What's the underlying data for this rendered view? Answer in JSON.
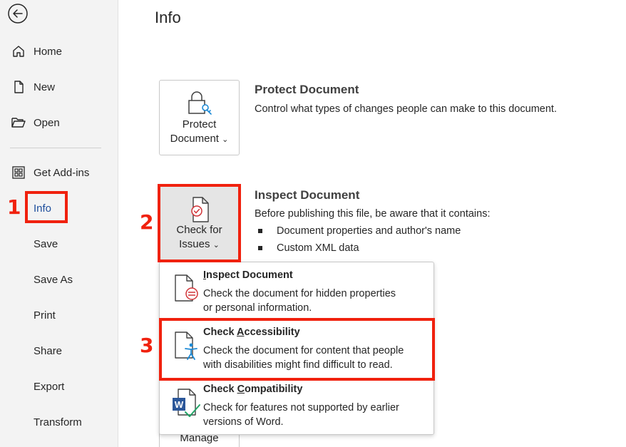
{
  "sidebar": {
    "items": [
      {
        "label": "Home"
      },
      {
        "label": "New"
      },
      {
        "label": "Open"
      },
      {
        "label": "Get Add-ins"
      },
      {
        "label": "Info"
      },
      {
        "label": "Save"
      },
      {
        "label": "Save As"
      },
      {
        "label": "Print"
      },
      {
        "label": "Share"
      },
      {
        "label": "Export"
      },
      {
        "label": "Transform"
      }
    ]
  },
  "callouts": [
    "1",
    "2",
    "3"
  ],
  "main": {
    "title": "Info",
    "protect": {
      "button_line1": "Protect",
      "button_line2": "Document",
      "chevron": "⌄",
      "title": "Protect Document",
      "desc": "Control what types of changes people can make to this document."
    },
    "inspect": {
      "button_line1": "Check for",
      "button_line2": "Issues",
      "chevron": "⌄",
      "title": "Inspect Document",
      "desc": "Before publishing this file, be aware that it contains:",
      "bullets": [
        "Document properties and author's name",
        "Custom XML data"
      ]
    },
    "manage_label": "Manage"
  },
  "dropdown": {
    "items": [
      {
        "title_prefix": "",
        "title_accel": "I",
        "title_rest": "nspect Document",
        "line1": "Check the document for hidden properties",
        "line2": "or personal information."
      },
      {
        "title_prefix": "Check ",
        "title_accel": "A",
        "title_rest": "ccessibility",
        "line1": "Check the document for content that people",
        "line2": "with disabilities might find difficult to read."
      },
      {
        "title_prefix": "Check ",
        "title_accel": "C",
        "title_rest": "ompatibility",
        "line1": "Check for features not supported by earlier",
        "line2": "versions of Word."
      }
    ]
  },
  "colors": {
    "accent": "#1e4e9c",
    "callout": "#f0210e",
    "word_blue": "#2b579a",
    "check_green": "#21a366",
    "issue_red": "#d13438"
  }
}
